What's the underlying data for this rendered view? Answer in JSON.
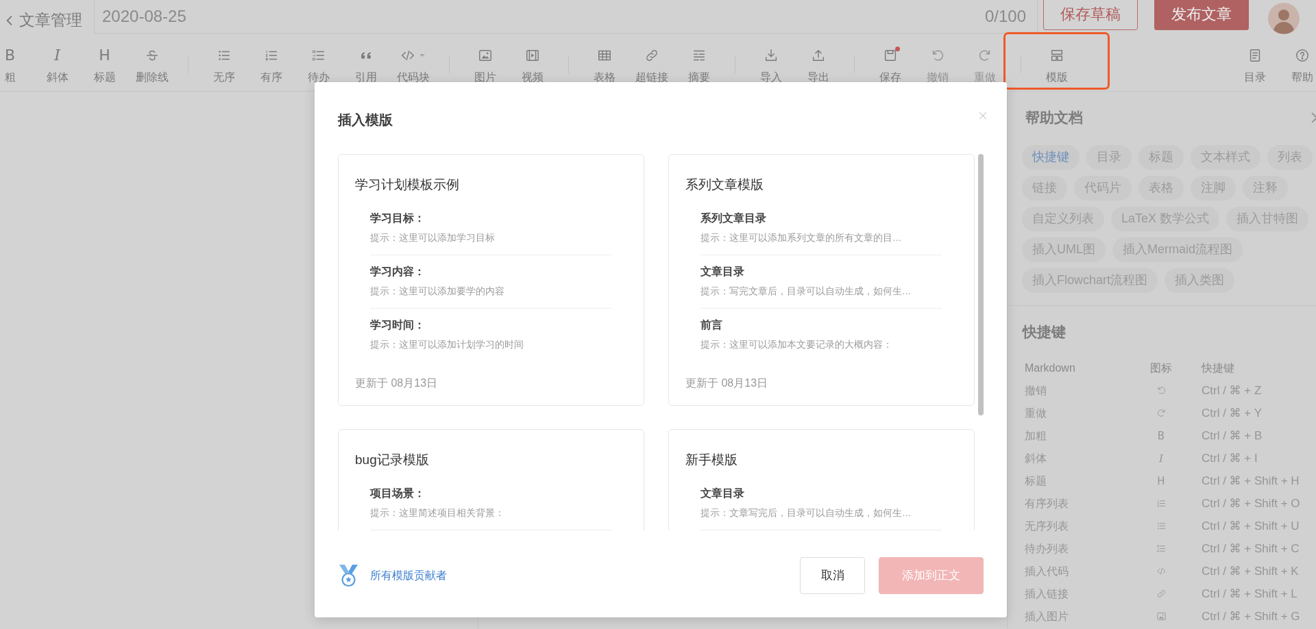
{
  "header": {
    "back_label": "文章管理",
    "title_value": "2020-08-25",
    "counter": "0/100",
    "buttons": [
      {
        "label": "保存草稿",
        "kind": "outline"
      },
      {
        "label": "发布文章",
        "kind": "primary"
      }
    ]
  },
  "toolbar": {
    "groups": [
      [
        {
          "label": "粗",
          "glyph": "B",
          "disabled": false,
          "highlighted": false,
          "dot": false
        },
        {
          "label": "斜体",
          "glyph": "I",
          "disabled": false,
          "highlighted": false,
          "dot": false
        },
        {
          "label": "标题",
          "glyph": "H",
          "disabled": false,
          "highlighted": false,
          "dot": false
        },
        {
          "label": "删除线",
          "disabled": false,
          "highlighted": false,
          "dot": false
        }
      ],
      [
        {
          "label": "无序",
          "disabled": false,
          "highlighted": false,
          "dot": false
        },
        {
          "label": "有序",
          "disabled": false,
          "highlighted": false,
          "dot": false
        },
        {
          "label": "待办",
          "disabled": false,
          "highlighted": false,
          "dot": false
        },
        {
          "label": "引用",
          "disabled": false,
          "highlighted": false,
          "dot": false
        },
        {
          "label": "代码块",
          "disabled": false,
          "highlighted": false,
          "dot": false
        }
      ],
      [
        {
          "label": "图片",
          "disabled": false,
          "highlighted": false,
          "dot": false
        },
        {
          "label": "视频",
          "disabled": false,
          "highlighted": false,
          "dot": false
        }
      ],
      [
        {
          "label": "表格",
          "disabled": false,
          "highlighted": false,
          "dot": false
        },
        {
          "label": "超链接",
          "disabled": false,
          "highlighted": false,
          "dot": false
        },
        {
          "label": "摘要",
          "disabled": false,
          "highlighted": false,
          "dot": false
        }
      ],
      [
        {
          "label": "导入",
          "disabled": false,
          "highlighted": false,
          "dot": false
        },
        {
          "label": "导出",
          "disabled": false,
          "highlighted": false,
          "dot": false
        }
      ],
      [
        {
          "label": "保存",
          "disabled": false,
          "highlighted": false,
          "dot": true
        },
        {
          "label": "撤销",
          "disabled": true,
          "highlighted": false,
          "dot": false
        },
        {
          "label": "重做",
          "disabled": true,
          "highlighted": false,
          "dot": false
        }
      ],
      [
        {
          "label": "模版",
          "disabled": false,
          "highlighted": true,
          "dot": false
        }
      ]
    ],
    "right": [
      {
        "label": "目录",
        "disabled": false,
        "highlighted": false,
        "dot": false
      },
      {
        "label": "帮助",
        "disabled": false,
        "highlighted": false,
        "dot": false
      }
    ]
  },
  "modal": {
    "title": "插入模版",
    "templates": [
      {
        "title": "学习计划模板示例",
        "sections": [
          {
            "heading": "学习目标：",
            "hint": "提示：这里可以添加学习目标"
          },
          {
            "heading": "学习内容：",
            "hint": "提示：这里可以添加要学的内容"
          },
          {
            "heading": "学习时间：",
            "hint": "提示：这里可以添加计划学习的时间"
          }
        ],
        "updated": "更新于 08月13日"
      },
      {
        "title": "系列文章模版",
        "sections": [
          {
            "heading": "系列文章目录",
            "hint": "提示：这里可以添加系列文章的所有文章的目…"
          },
          {
            "heading": "文章目录",
            "hint": "提示：写完文章后，目录可以自动生成，如何生…"
          },
          {
            "heading": "前言",
            "hint": "提示：这里可以添加本文要记录的大概内容："
          }
        ],
        "updated": "更新于 08月13日"
      },
      {
        "title": "bug记录模版",
        "sections": [
          {
            "heading": "项目场景：",
            "hint": "提示：这里简述项目相关背景："
          }
        ]
      },
      {
        "title": "新手模版",
        "sections": [
          {
            "heading": "文章目录",
            "hint": "提示：文章写完后，目录可以自动生成，如何生…"
          }
        ]
      }
    ],
    "footer_link": "所有模版贡献者",
    "buttons": [
      {
        "label": "取消",
        "kind": "default",
        "disabled": false
      },
      {
        "label": "添加到正文",
        "kind": "primary",
        "disabled": true
      }
    ]
  },
  "help_panel": {
    "title": "帮助文档",
    "tag_rows": [
      [
        {
          "label": "快捷键",
          "selected": true
        },
        {
          "label": "目录",
          "selected": false
        },
        {
          "label": "标题",
          "selected": false
        },
        {
          "label": "文本样式",
          "selected": false
        },
        {
          "label": "列表",
          "selected": false
        }
      ],
      [
        {
          "label": "链接",
          "selected": false
        },
        {
          "label": "代码片",
          "selected": false
        },
        {
          "label": "表格",
          "selected": false
        },
        {
          "label": "注脚",
          "selected": false
        },
        {
          "label": "注释",
          "selected": false
        }
      ],
      [
        {
          "label": "自定义列表",
          "selected": false
        },
        {
          "label": "LaTeX 数学公式",
          "selected": false
        },
        {
          "label": "插入甘特图",
          "selected": false
        }
      ],
      [
        {
          "label": "插入UML图",
          "selected": false
        },
        {
          "label": "插入Mermaid流程图",
          "selected": false
        }
      ],
      [
        {
          "label": "插入Flowchart流程图",
          "selected": false
        },
        {
          "label": "插入类图",
          "selected": false
        }
      ]
    ],
    "section_title": "快捷键",
    "table": {
      "columns": [
        "Markdown",
        "图标",
        "快捷键"
      ],
      "rows": [
        {
          "name": "撤销",
          "shortcut": "Ctrl / ⌘ + Z"
        },
        {
          "name": "重做",
          "shortcut": "Ctrl / ⌘ + Y"
        },
        {
          "name": "加粗",
          "glyph": "B",
          "shortcut": "Ctrl / ⌘ + B"
        },
        {
          "name": "斜体",
          "glyph": "I",
          "shortcut": "Ctrl / ⌘ + I"
        },
        {
          "name": "标题",
          "glyph": "H",
          "shortcut": "Ctrl / ⌘ + Shift + H"
        },
        {
          "name": "有序列表",
          "shortcut": "Ctrl / ⌘ + Shift + O"
        },
        {
          "name": "无序列表",
          "shortcut": "Ctrl / ⌘ + Shift + U"
        },
        {
          "name": "待办列表",
          "shortcut": "Ctrl / ⌘ + Shift + C"
        },
        {
          "name": "插入代码",
          "shortcut": "Ctrl / ⌘ + Shift + K"
        },
        {
          "name": "插入链接",
          "shortcut": "Ctrl / ⌘ + Shift + L"
        },
        {
          "name": "插入图片",
          "shortcut": "Ctrl / ⌘ + Shift + G"
        }
      ]
    }
  }
}
